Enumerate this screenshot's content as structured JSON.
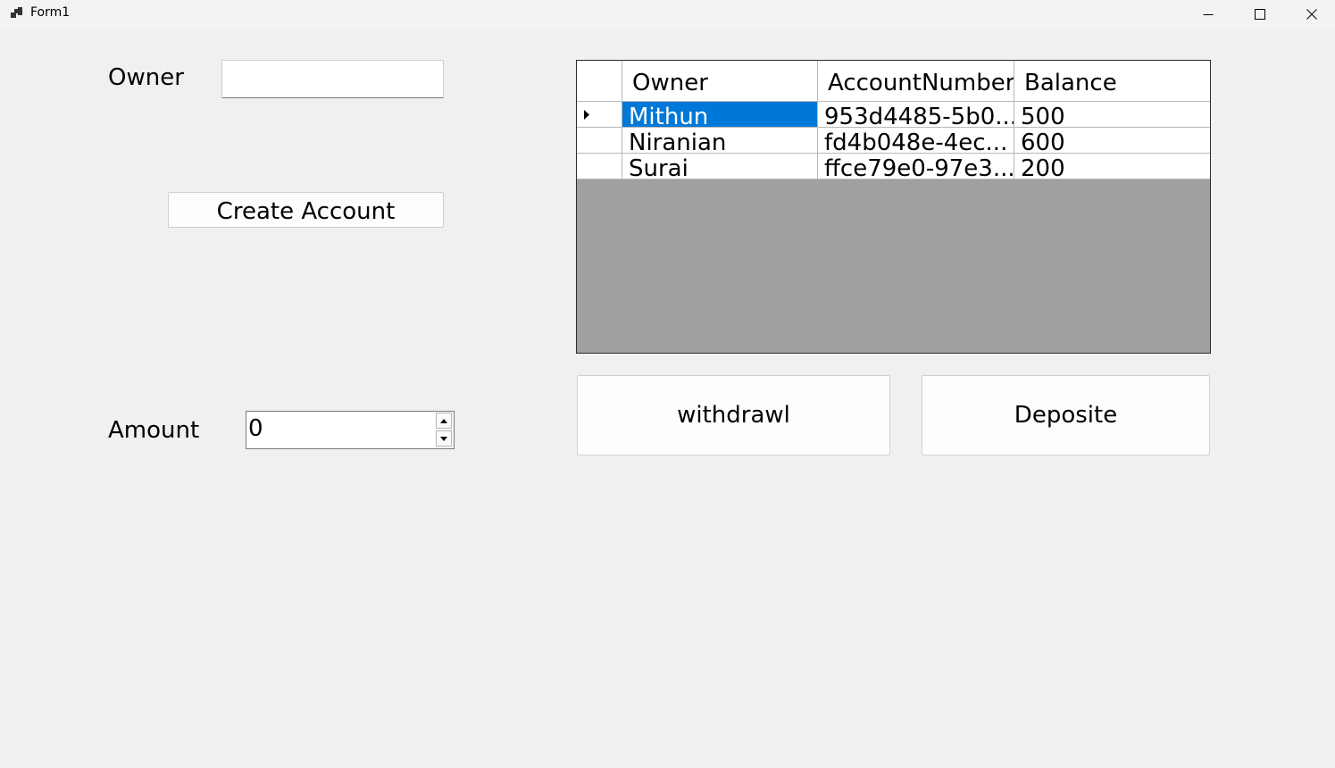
{
  "window": {
    "title": "Form1"
  },
  "form": {
    "owner_label": "Owner",
    "owner_value": "",
    "create_button": "Create Account",
    "amount_label": "Amount",
    "amount_value": "0",
    "withdraw_button": "withdrawl",
    "deposit_button": "Deposite"
  },
  "grid": {
    "columns": [
      "Owner",
      "AccountNumber",
      "Balance"
    ],
    "rows": [
      {
        "owner": "Mithun",
        "account": "953d4485-5b0...",
        "balance": "500",
        "selected": true
      },
      {
        "owner": "Niranian",
        "account": "fd4b048e-4ec...",
        "balance": "600",
        "selected": false
      },
      {
        "owner": "Surai",
        "account": "ffce79e0-97e3...",
        "balance": "200",
        "selected": false
      }
    ]
  },
  "colors": {
    "selection": "#0078d7",
    "grid_empty_area": "#a0a0a0",
    "form_background": "#f0f0f0"
  }
}
